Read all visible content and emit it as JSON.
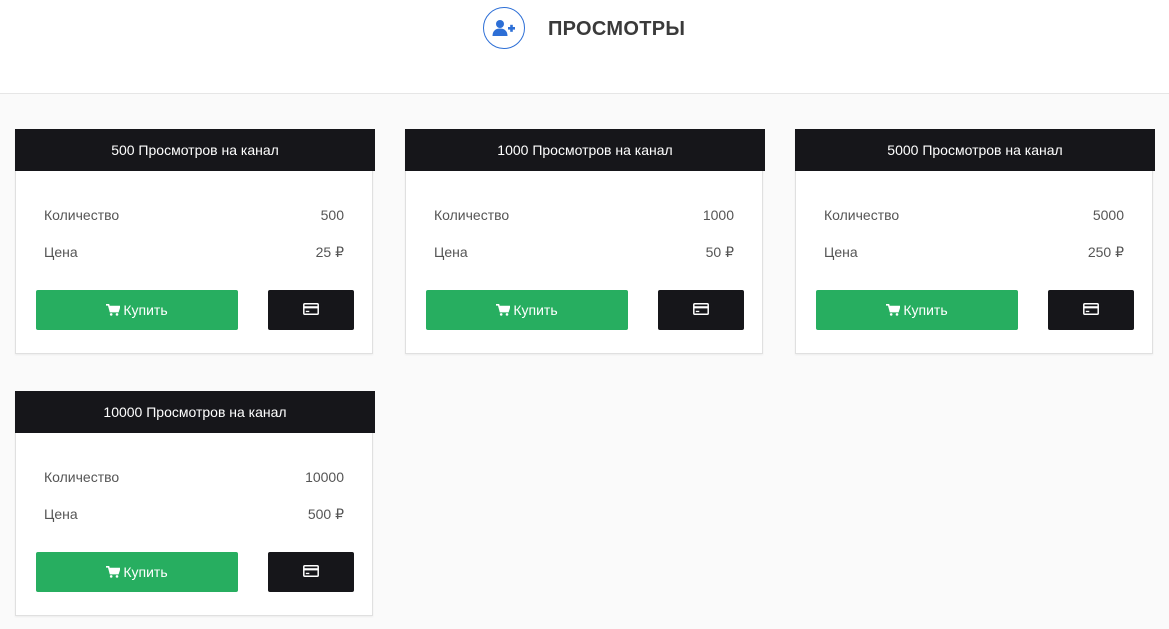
{
  "header": {
    "title": "ПРОСМОТРЫ",
    "icon": "user-plus-icon",
    "accent_color": "#2d6fd6"
  },
  "cards": [
    {
      "title": "500 Просмотров на канал",
      "qty_label": "Количество",
      "qty": "500",
      "price_label": "Цена",
      "price": "25 ₽",
      "buy_label": "Купить"
    },
    {
      "title": "1000 Просмотров на канал",
      "qty_label": "Количество",
      "qty": "1000",
      "price_label": "Цена",
      "price": "50 ₽",
      "buy_label": "Купить"
    },
    {
      "title": "5000 Просмотров на канал",
      "qty_label": "Количество",
      "qty": "5000",
      "price_label": "Цена",
      "price": "250 ₽",
      "buy_label": "Купить"
    },
    {
      "title": "10000 Просмотров на канал",
      "qty_label": "Количество",
      "qty": "10000",
      "price_label": "Цена",
      "price": "500 ₽",
      "buy_label": "Купить"
    }
  ],
  "colors": {
    "buy_button": "#27ae60",
    "dark": "#16161a"
  },
  "icons": {
    "buy": "cart-icon",
    "card_pay": "credit-card-icon"
  }
}
